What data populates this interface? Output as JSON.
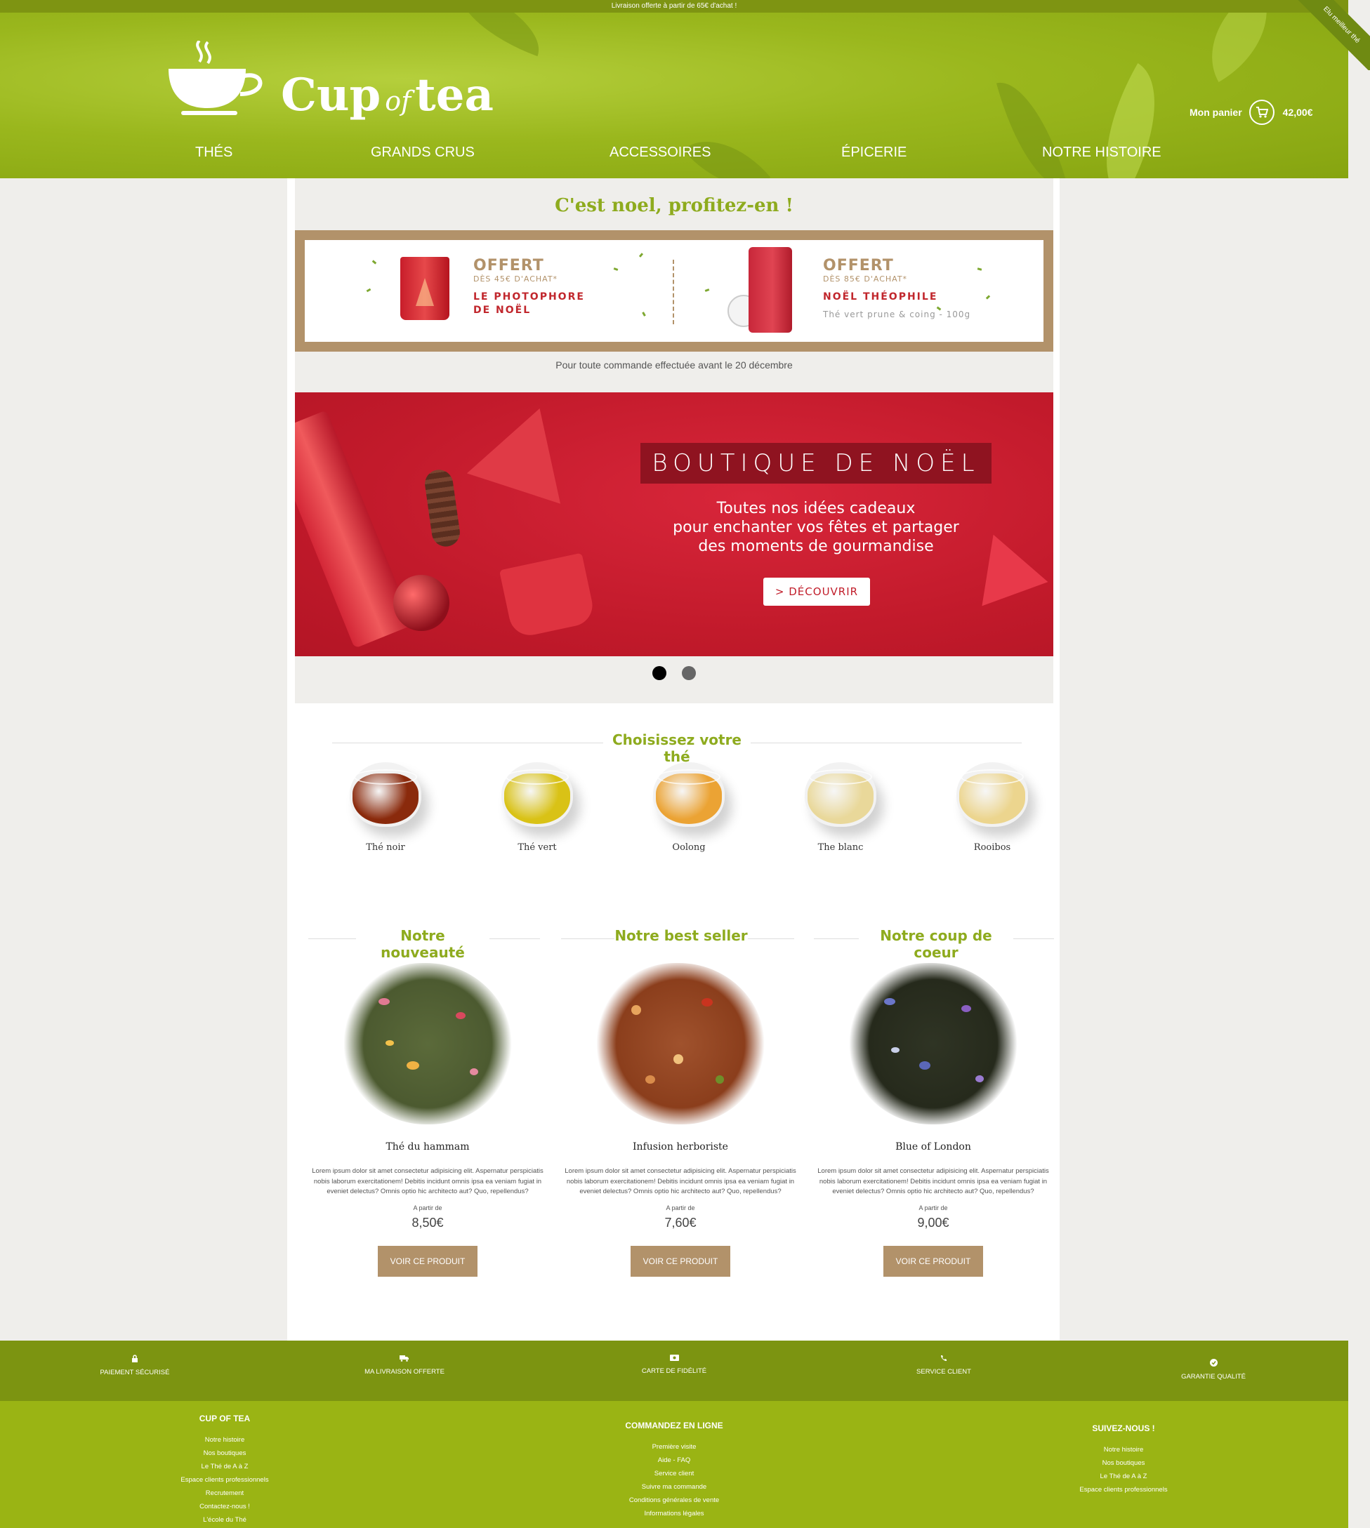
{
  "topbar": {
    "text": "Livraison offerte à partir de 65€ d'achat !"
  },
  "ribbon": {
    "text": "Elu meilleur thé"
  },
  "logo": {
    "cup": "Cup",
    "of": "of",
    "tea": "tea"
  },
  "cart": {
    "label": "Mon panier",
    "amount": "42,00€",
    "icon": "cart-icon"
  },
  "nav": [
    "THÉS",
    "GRANDS CRUS",
    "ACCESSOIRES",
    "ÉPICERIE",
    "NOTRE HISTOIRE"
  ],
  "promo": {
    "title": "C'est noel, profitez-en !",
    "offer1": {
      "headline": "OFFERT",
      "condition": "DÈS 45€ D'ACHAT*",
      "product_line1": "LE PHOTOPHORE",
      "product_line2": "DE NOËL"
    },
    "offer2": {
      "headline": "OFFERT",
      "condition": "DÈS 85€ D'ACHAT*",
      "product_line1": "NOËL THÉOPHILE",
      "description": "Thé vert prune & coing - 100g"
    },
    "note": "Pour toute commande effectuée avant le 20 décembre"
  },
  "slider": {
    "heading": "BOUTIQUE DE NOËL",
    "line1": "Toutes nos idées cadeaux",
    "line2": "pour enchanter vos fêtes et partager",
    "line3": "des moments de gourmandise",
    "button": "> DÉCOUVRIR",
    "slide_count": 2,
    "active_slide": 1
  },
  "choose": {
    "title": "Choisissez votre thé",
    "items": [
      {
        "label": "Thé noir",
        "color": "#8a2a0c"
      },
      {
        "label": "Thé vert",
        "color": "#d9c216"
      },
      {
        "label": "Oolong",
        "color": "#eba334"
      },
      {
        "label": "The blanc",
        "color": "#e9d89a"
      },
      {
        "label": "Rooibos",
        "color": "#ecd58e"
      }
    ]
  },
  "products": [
    {
      "section": "Notre nouveauté",
      "name": "Thé du hammam",
      "desc": "Lorem ipsum dolor sit amet consectetur adipisicing elit. Aspernatur perspiciatis nobis laborum exercitationem! Debitis incidunt omnis ipsa ea veniam fugiat in eveniet delectus? Omnis optio hic architecto aut? Quo, repellendus?",
      "from": "A partir de",
      "price": "8,50€",
      "button": "VOIR CE PRODUIT"
    },
    {
      "section": "Notre best seller",
      "name": "Infusion herboriste",
      "desc": "Lorem ipsum dolor sit amet consectetur adipisicing elit. Aspernatur perspiciatis nobis laborum exercitationem! Debitis incidunt omnis ipsa ea veniam fugiat in eveniet delectus? Omnis optio hic architecto aut? Quo, repellendus?",
      "from": "A partir de",
      "price": "7,60€",
      "button": "VOIR CE PRODUIT"
    },
    {
      "section": "Notre coup de coeur",
      "name": "Blue of London",
      "desc": "Lorem ipsum dolor sit amet consectetur adipisicing elit. Aspernatur perspiciatis nobis laborum exercitationem! Debitis incidunt omnis ipsa ea veniam fugiat in eveniet delectus? Omnis optio hic architecto aut? Quo, repellendus?",
      "from": "A partir de",
      "price": "9,00€",
      "button": "VOIR CE PRODUIT"
    }
  ],
  "features": [
    {
      "label": "PAIEMENT SÉCURISÉ",
      "icon": "lock-icon"
    },
    {
      "label": "MA LIVRAISON OFFERTE",
      "icon": "truck-icon"
    },
    {
      "label": "CARTE DE FIDÉLITÉ",
      "icon": "card-icon"
    },
    {
      "label": "SERVICE CLIENT",
      "icon": "phone-icon"
    },
    {
      "label": "GARANTIE QUALITÉ",
      "icon": "check-icon"
    }
  ],
  "footer": {
    "col1": {
      "title": "CUP OF TEA",
      "links": [
        "Notre histoire",
        "Nos boutiques",
        "Le Thé de A à Z",
        "Espace clients professionnels",
        "Recrutement",
        "Contactez-nous !",
        "L'école du Thé"
      ]
    },
    "col2": {
      "title": "COMMANDEZ EN LIGNE",
      "links": [
        "Première visite",
        "Aide - FAQ",
        "Service client",
        "Suivre ma commande",
        "Conditions générales de vente",
        "Informations légales"
      ]
    },
    "col3": {
      "title": "SUIVEZ-NOUS !",
      "links": [
        "Notre histoire",
        "Nos boutiques",
        "Le Thé de A à Z",
        "Espace clients professionnels"
      ]
    }
  }
}
